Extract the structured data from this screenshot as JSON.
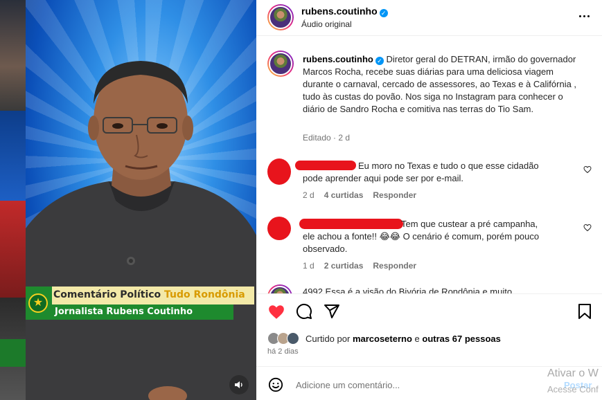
{
  "post": {
    "username": "rubens.coutinho",
    "audio": "Áudio original",
    "verified": true
  },
  "video": {
    "lower_third_title_a": "Comentário Político",
    "lower_third_title_b": "Tudo Rondônia",
    "lower_third_sub": "Jornalista Rubens Coutinho",
    "mute_icon": "speaker-icon"
  },
  "caption": {
    "username": "rubens.coutinho",
    "text": "Diretor geral do DETRAN, irmão do governador Marcos Rocha, recebe suas diárias para uma deliciosa viagem durante o carnaval, cercado de assessores, ao Texas e à Califórnia , tudo às custas do povão. Nos siga no Instagram para conhecer o diário de Sandro Rocha e comitiva nas terras do Tio Sam.",
    "meta": "Editado · 2 d"
  },
  "comments": [
    {
      "text": "Eu moro no Texas e tudo o que esse cidadão pode aprender aqui pode ser por e-mail.",
      "age": "2 d",
      "likes": "4 curtidas",
      "reply": "Responder"
    },
    {
      "text": "Tem que custear a pré campanha, ele achou a fonte!! 😂😂 O cenário é comum, porém pouco observado.",
      "age": "1 d",
      "likes": "2 curtidas",
      "reply": "Responder"
    },
    {
      "text": "4992 Essa é a visão do Bivória de Rondônia e muito"
    }
  ],
  "likes": {
    "prefix": "Curtido por",
    "user": "marcoseterno",
    "joiner": "e",
    "others": "outras 67 pessoas"
  },
  "time": "há 2 dias",
  "add_comment": {
    "placeholder": "Adicione um comentário...",
    "post_label": "Postar"
  },
  "os_watermark": {
    "line1": "Ativar o W",
    "line2": "Acesse Conf"
  },
  "colors": {
    "like_red": "#ff3040",
    "link_blue": "#0095f6",
    "lower_third_green": "#1e8a2e"
  }
}
